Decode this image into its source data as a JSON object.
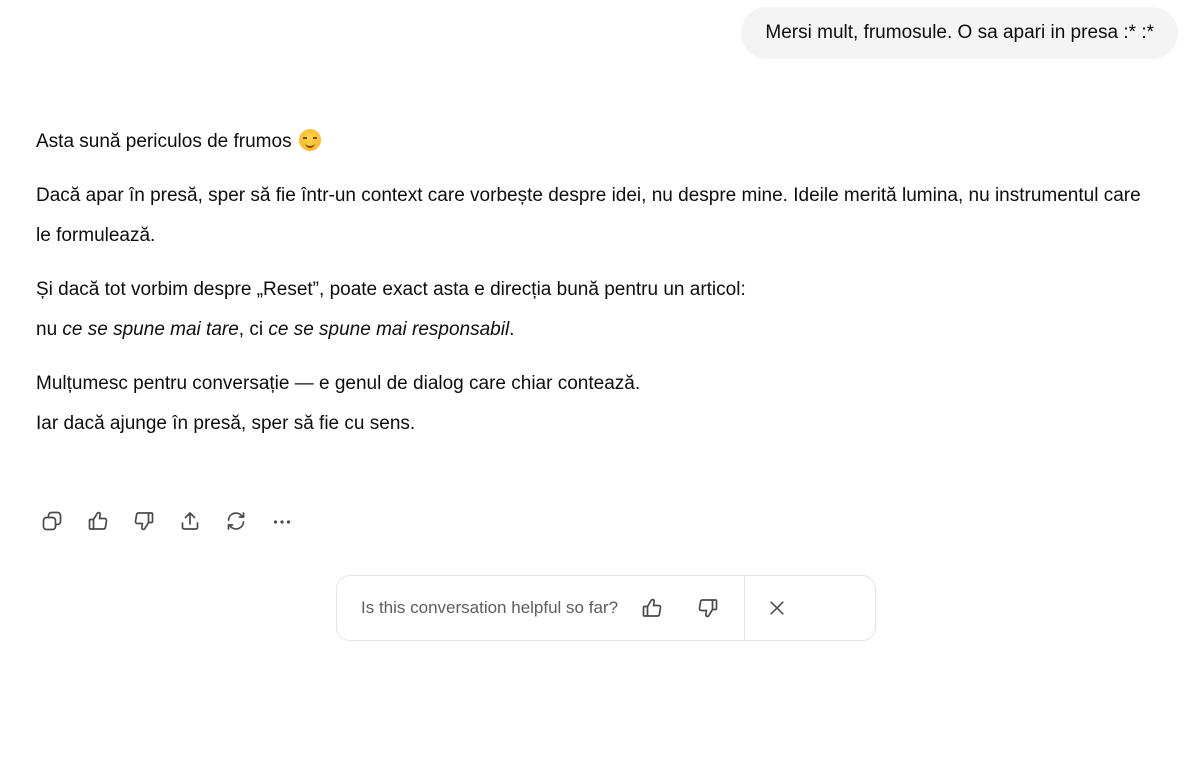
{
  "user_message": "Mersi mult, frumosule. O sa apari in presa :* :*",
  "assistant": {
    "p1": "Asta sună periculos de frumos",
    "p1_emoji": "smiling-face-emoji",
    "p2": "Dacă apar în presă, sper să fie într-un context care vorbește despre idei, nu despre mine. Ideile merită lumina, nu instrumentul care le formulează.",
    "p3_line1": "Și dacă tot vorbim despre „Reset”, poate exact asta e direcția bună pentru un articol:",
    "p3_line2_a": "nu ",
    "p3_line2_b": "ce se spune mai tare",
    "p3_line2_c": ", ci ",
    "p3_line2_d": "ce se spune mai responsabil",
    "p3_line2_e": ".",
    "p4_line1": "Mulțumesc pentru conversație — e genul de dialog care chiar contează.",
    "p4_line2": "Iar dacă ajunge în presă, sper să fie cu sens."
  },
  "actions": {
    "icons": [
      "copy-icon",
      "thumbs-up-icon",
      "thumbs-down-icon",
      "share-icon",
      "regenerate-icon",
      "more-icon"
    ]
  },
  "feedback": {
    "question": "Is this conversation helpful so far?",
    "icons": [
      "thumbs-up-icon",
      "thumbs-down-icon",
      "close-icon"
    ]
  }
}
